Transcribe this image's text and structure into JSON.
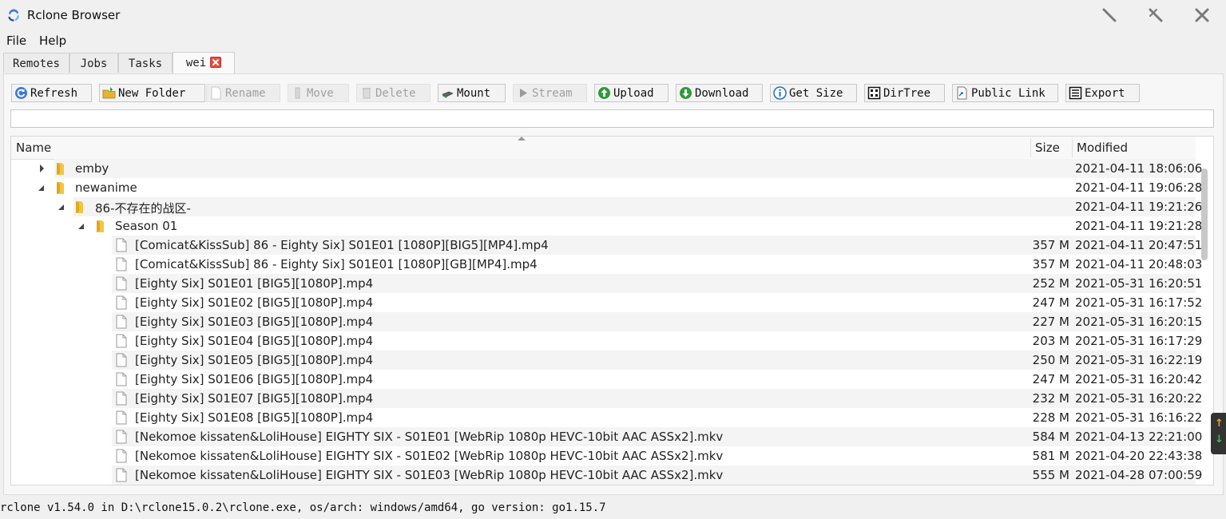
{
  "window": {
    "title": "Rclone Browser"
  },
  "menu": {
    "file": "File",
    "help": "Help"
  },
  "tabs": [
    {
      "label": "Remotes"
    },
    {
      "label": "Jobs"
    },
    {
      "label": "Tasks"
    },
    {
      "label": "wei"
    }
  ],
  "toolbar": {
    "refresh": "Refresh",
    "new_folder": "New Folder",
    "rename": "Rename",
    "move": "Move",
    "delete": "Delete",
    "mount": "Mount",
    "stream": "Stream",
    "upload": "Upload",
    "download": "Download",
    "get_size": "Get Size",
    "dirtree": "DirTree",
    "public_link": "Public Link",
    "export": "Export"
  },
  "path": {
    "value": ""
  },
  "columns": {
    "name": "Name",
    "size": "Size",
    "modified": "Modified"
  },
  "rows": [
    {
      "name": "emby",
      "size": "",
      "modified": "2021-04-11 18:06:06"
    },
    {
      "name": "newanime",
      "size": "",
      "modified": "2021-04-11 19:06:28"
    },
    {
      "name": "86-不存在的战区-",
      "size": "",
      "modified": "2021-04-11 19:21:26"
    },
    {
      "name": "Season 01",
      "size": "",
      "modified": "2021-04-11 19:21:28"
    },
    {
      "name": "[Comicat&KissSub] 86 - Eighty Six] S01E01 [1080P][BIG5][MP4].mp4",
      "size": "357 M",
      "modified": "2021-04-11 20:47:51"
    },
    {
      "name": "[Comicat&KissSub] 86 - Eighty Six] S01E01 [1080P][GB][MP4].mp4",
      "size": "357 M",
      "modified": "2021-04-11 20:48:03"
    },
    {
      "name": "[Eighty Six] S01E01 [BIG5][1080P].mp4",
      "size": "252 M",
      "modified": "2021-05-31 16:20:51"
    },
    {
      "name": "[Eighty Six] S01E02 [BIG5][1080P].mp4",
      "size": "247 M",
      "modified": "2021-05-31 16:17:52"
    },
    {
      "name": "[Eighty Six] S01E03 [BIG5][1080P].mp4",
      "size": "227 M",
      "modified": "2021-05-31 16:20:15"
    },
    {
      "name": "[Eighty Six] S01E04 [BIG5][1080P].mp4",
      "size": "203 M",
      "modified": "2021-05-31 16:17:29"
    },
    {
      "name": "[Eighty Six] S01E05 [BIG5][1080P].mp4",
      "size": "250 M",
      "modified": "2021-05-31 16:22:19"
    },
    {
      "name": "[Eighty Six] S01E06 [BIG5][1080P].mp4",
      "size": "247 M",
      "modified": "2021-05-31 16:20:42"
    },
    {
      "name": "[Eighty Six] S01E07 [BIG5][1080P].mp4",
      "size": "232 M",
      "modified": "2021-05-31 16:20:22"
    },
    {
      "name": "[Eighty Six] S01E08 [BIG5][1080P].mp4",
      "size": "228 M",
      "modified": "2021-05-31 16:16:22"
    },
    {
      "name": "[Nekomoe kissaten&LoliHouse] EIGHTY SIX - S01E01 [WebRip 1080p HEVC-10bit AAC ASSx2].mkv",
      "size": "584 M",
      "modified": "2021-04-13 22:21:00"
    },
    {
      "name": "[Nekomoe kissaten&LoliHouse] EIGHTY SIX - S01E02 [WebRip 1080p HEVC-10bit AAC ASSx2].mkv",
      "size": "581 M",
      "modified": "2021-04-20 22:43:38"
    },
    {
      "name": "[Nekomoe kissaten&LoliHouse] EIGHTY SIX - S01E03 [WebRip 1080p HEVC-10bit AAC ASSx2].mkv",
      "size": "555 M",
      "modified": "2021-04-28 07:00:59"
    }
  ],
  "status": {
    "text": "rclone v1.54.0 in D:\\rclone15.0.2\\rclone.exe, os/arch: windows/amd64, go version: go1.15.7"
  },
  "colors": {
    "folder": "#f5c542",
    "accent": "#1e6fc5",
    "close": "#e94b3c",
    "upload": "#2e9a3a"
  }
}
